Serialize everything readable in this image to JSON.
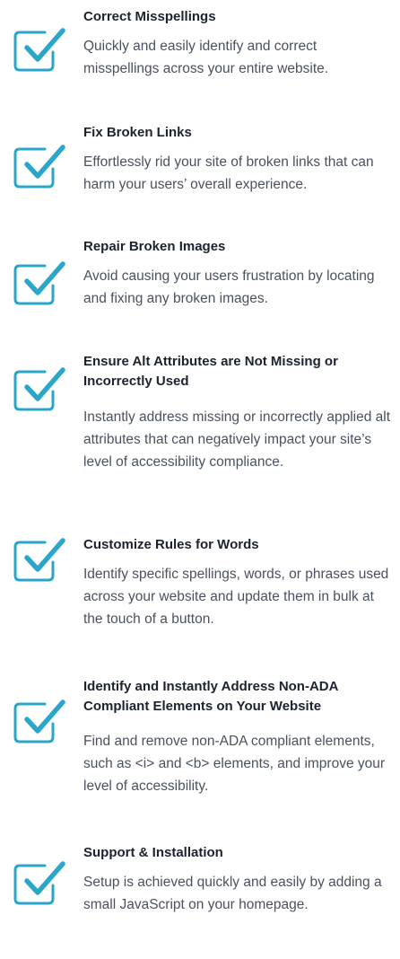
{
  "colors": {
    "accent": "#2aa6c9",
    "title": "#1c2230",
    "body": "#4a5160",
    "background": "#ffffff"
  },
  "features": [
    {
      "icon": "checkbox-check-icon",
      "title": "Correct Misspellings",
      "description": "Quickly and easily identify and correct misspellings across your entire website."
    },
    {
      "icon": "checkbox-check-icon",
      "title": "Fix Broken Links",
      "description": "Effortlessly rid your site of broken links that can harm your users’ overall experience."
    },
    {
      "icon": "checkbox-check-icon",
      "title": "Repair Broken Images",
      "description": "Avoid causing your users frustration by locating and fixing any broken images."
    },
    {
      "icon": "checkbox-check-icon",
      "title": "Ensure Alt Attributes are Not Missing or Incorrectly Used",
      "description": "Instantly address missing or incorrectly applied alt attributes that can negatively impact your site’s level of accessibility compliance."
    },
    {
      "icon": "checkbox-check-icon",
      "title": "Customize Rules for Words",
      "description": "Identify specific spellings, words, or phrases used across your website and update them in bulk at the touch of a button."
    },
    {
      "icon": "checkbox-check-icon",
      "title": "Identify and Instantly Address Non-ADA Compliant Elements on Your Website",
      "description": "Find and remove non-ADA compliant elements, such as <i> and <b> elements, and improve your level of accessibility."
    },
    {
      "icon": "checkbox-check-icon",
      "title": "Support & Installation",
      "description": "Setup is achieved quickly and easily by adding a small JavaScript on your homepage."
    }
  ]
}
